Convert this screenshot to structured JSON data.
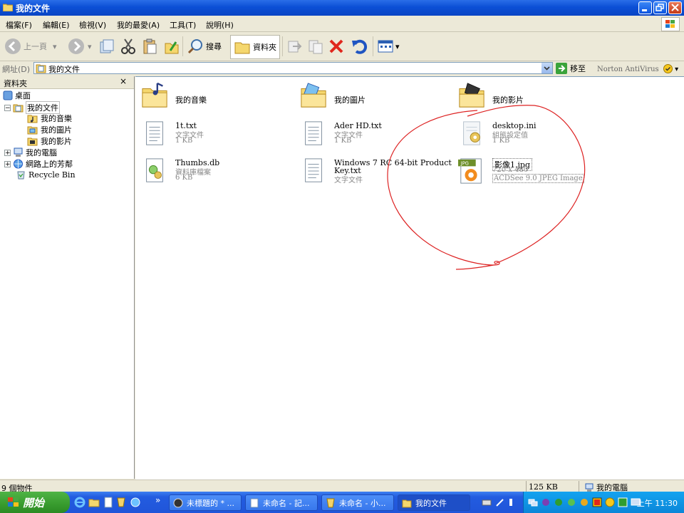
{
  "window": {
    "title": "我的文件"
  },
  "menu": [
    "檔案(F)",
    "編輯(E)",
    "檢視(V)",
    "我的最愛(A)",
    "工具(T)",
    "說明(H)"
  ],
  "toolbar": {
    "back_label": "上一頁",
    "search_label": "搜尋",
    "folders_label": "資料夾"
  },
  "address": {
    "label": "網址(D)",
    "value": "我的文件",
    "go_label": "移至",
    "norton_label": "Norton AntiVirus"
  },
  "folder_pane": {
    "title": "資料夾",
    "close_glyph": "×",
    "tree": [
      {
        "label": "桌面"
      },
      {
        "label": "我的文件"
      },
      {
        "label": "我的音樂"
      },
      {
        "label": "我的圖片"
      },
      {
        "label": "我的影片"
      },
      {
        "label": "我的電腦"
      },
      {
        "label": "網路上的芳鄰"
      },
      {
        "label": "Recycle Bin"
      }
    ]
  },
  "files": [
    {
      "name": "我的音樂"
    },
    {
      "name": "我的圖片"
    },
    {
      "name": "我的影片"
    },
    {
      "name": "1t.txt",
      "type": "文字文件",
      "size": "1 KB"
    },
    {
      "name": "Ader HD.txt",
      "type": "文字文件",
      "size": "1 KB"
    },
    {
      "name": "desktop.ini",
      "type": "組態設定值",
      "size": "1 KB"
    },
    {
      "name": "Thumbs.db",
      "type": "資料庫檔案",
      "size": "6 KB"
    },
    {
      "name": "Windows 7 RC 64-bit Product",
      "name2": "Key.txt",
      "type": "文字文件"
    },
    {
      "name": "影像1.jpg",
      "dims": "720 x 480",
      "type": "ACDSee 9.0 JPEG Image",
      "badge": "JPG"
    }
  ],
  "annotation": {
    "color": "#dd2222"
  },
  "status": {
    "count": "9 個物件",
    "size": "125 KB",
    "zone": "我的電腦"
  },
  "taskbar": {
    "start_label": "開始",
    "chevron": "»",
    "tasks": [
      "未標題的 * ...",
      "未命名 - 記...",
      "未命名 - 小...",
      "我的文件"
    ],
    "clock": "上午 11:30"
  }
}
